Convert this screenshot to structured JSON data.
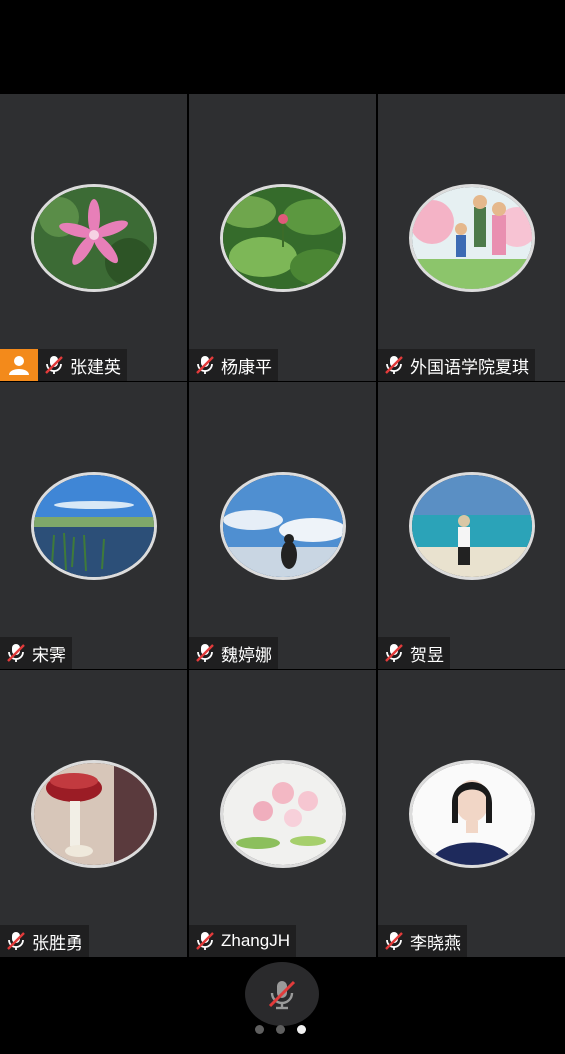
{
  "participants": [
    {
      "name": "张建英",
      "is_host": true,
      "muted": true,
      "avatar": "pink-lily-flower"
    },
    {
      "name": "杨康平",
      "is_host": false,
      "muted": true,
      "avatar": "lotus-leaves"
    },
    {
      "name": "外国语学院夏琪",
      "is_host": false,
      "muted": true,
      "avatar": "cartoon-family"
    },
    {
      "name": "宋霁",
      "is_host": false,
      "muted": true,
      "avatar": "lake-wetland"
    },
    {
      "name": "魏婷娜",
      "is_host": false,
      "muted": true,
      "avatar": "sky-silhouette"
    },
    {
      "name": "贺昱",
      "is_host": false,
      "muted": true,
      "avatar": "beach-person"
    },
    {
      "name": "张胜勇",
      "is_host": false,
      "muted": true,
      "avatar": "dancer-red-skirt"
    },
    {
      "name": "ZhangJH",
      "is_host": false,
      "muted": true,
      "avatar": "pink-blossoms"
    },
    {
      "name": "李晓燕",
      "is_host": false,
      "muted": true,
      "avatar": "woman-portrait"
    }
  ],
  "icons": {
    "muted_mic": "muted-mic-icon",
    "host": "host-person-icon"
  },
  "colors": {
    "host_badge": "#f38a1b",
    "mute_slash": "#e23b3b",
    "tile_bg": "#2e2f31"
  },
  "pager": {
    "pages": 3,
    "current": 3
  }
}
